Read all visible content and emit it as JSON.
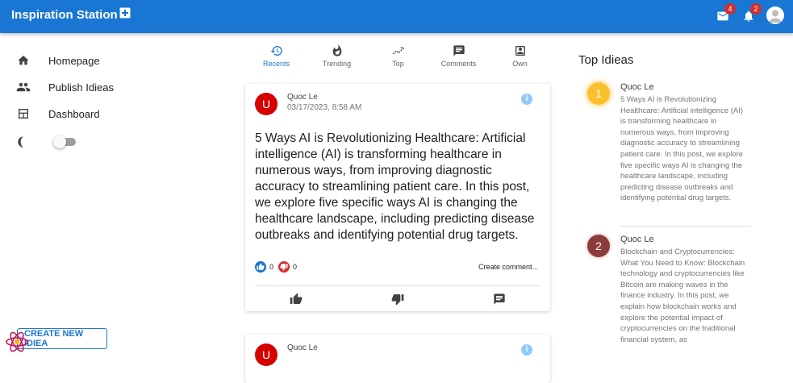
{
  "app": {
    "title": "Inspiration Station",
    "mail_badge": "4",
    "notification_badge": "2"
  },
  "sidebar": {
    "items": [
      {
        "label": "Homepage",
        "icon": "home-icon"
      },
      {
        "label": "Publish Idieas",
        "icon": "people-icon"
      },
      {
        "label": "Dashboard",
        "icon": "dashboard-icon"
      }
    ],
    "theme_icon": "half-moon-icon",
    "dark_mode": false,
    "create_button": "CREATE NEW IDIEA"
  },
  "tabs": [
    {
      "label": "Recents",
      "icon": "history-icon",
      "active": true
    },
    {
      "label": "Trending",
      "icon": "flame-icon",
      "active": false
    },
    {
      "label": "Top",
      "icon": "trend-icon",
      "active": false
    },
    {
      "label": "Comments",
      "icon": "comment-icon",
      "active": false
    },
    {
      "label": "Own",
      "icon": "account-box-icon",
      "active": false
    }
  ],
  "posts": [
    {
      "avatar_letter": "U",
      "author": "Quoc Le",
      "date": "03/17/2023, 8:58 AM",
      "body": "5 Ways AI is Revolutionizing Healthcare: Artificial intelligence (AI) is transforming healthcare in numerous ways, from improving diagnostic accuracy to streamlining patient care. In this post, we explore five specific ways AI is changing the healthcare landscape, including predicting disease outbreaks and identifying potential drug targets.",
      "likes": "0",
      "dislikes": "0",
      "comment_prompt": "Create comment..."
    },
    {
      "avatar_letter": "U",
      "author": "Quoc Le"
    }
  ],
  "top_ideas": {
    "title": "Top Idieas",
    "items": [
      {
        "rank": "1",
        "author": "Quoc Le",
        "text": "5 Ways AI is Revolutionizing Healthcare: Artificial intelligence (AI) is transforming healthcare in numerous ways, from improving diagnostic accuracy to streamlining patient care. In this post, we explore five specific ways AI is changing the healthcare landscape, including predicting disease outbreaks and identifying potential drug targets."
      },
      {
        "rank": "2",
        "author": "Quoc Le",
        "text": "Blockchain and Cryptocurrencies: What You Need to Know: Blockchain technology and cryptocurrencies like Bitcoin are making waves in the finance industry. In this post, we explain how blockchain works and explore the potential impact of cryptocurrencies on the traditional financial system, as"
      }
    ]
  },
  "colors": {
    "primary": "#1976d2",
    "rank1": "#fbc02d",
    "rank2": "#8d3a3a",
    "avatar": "#d50000"
  }
}
